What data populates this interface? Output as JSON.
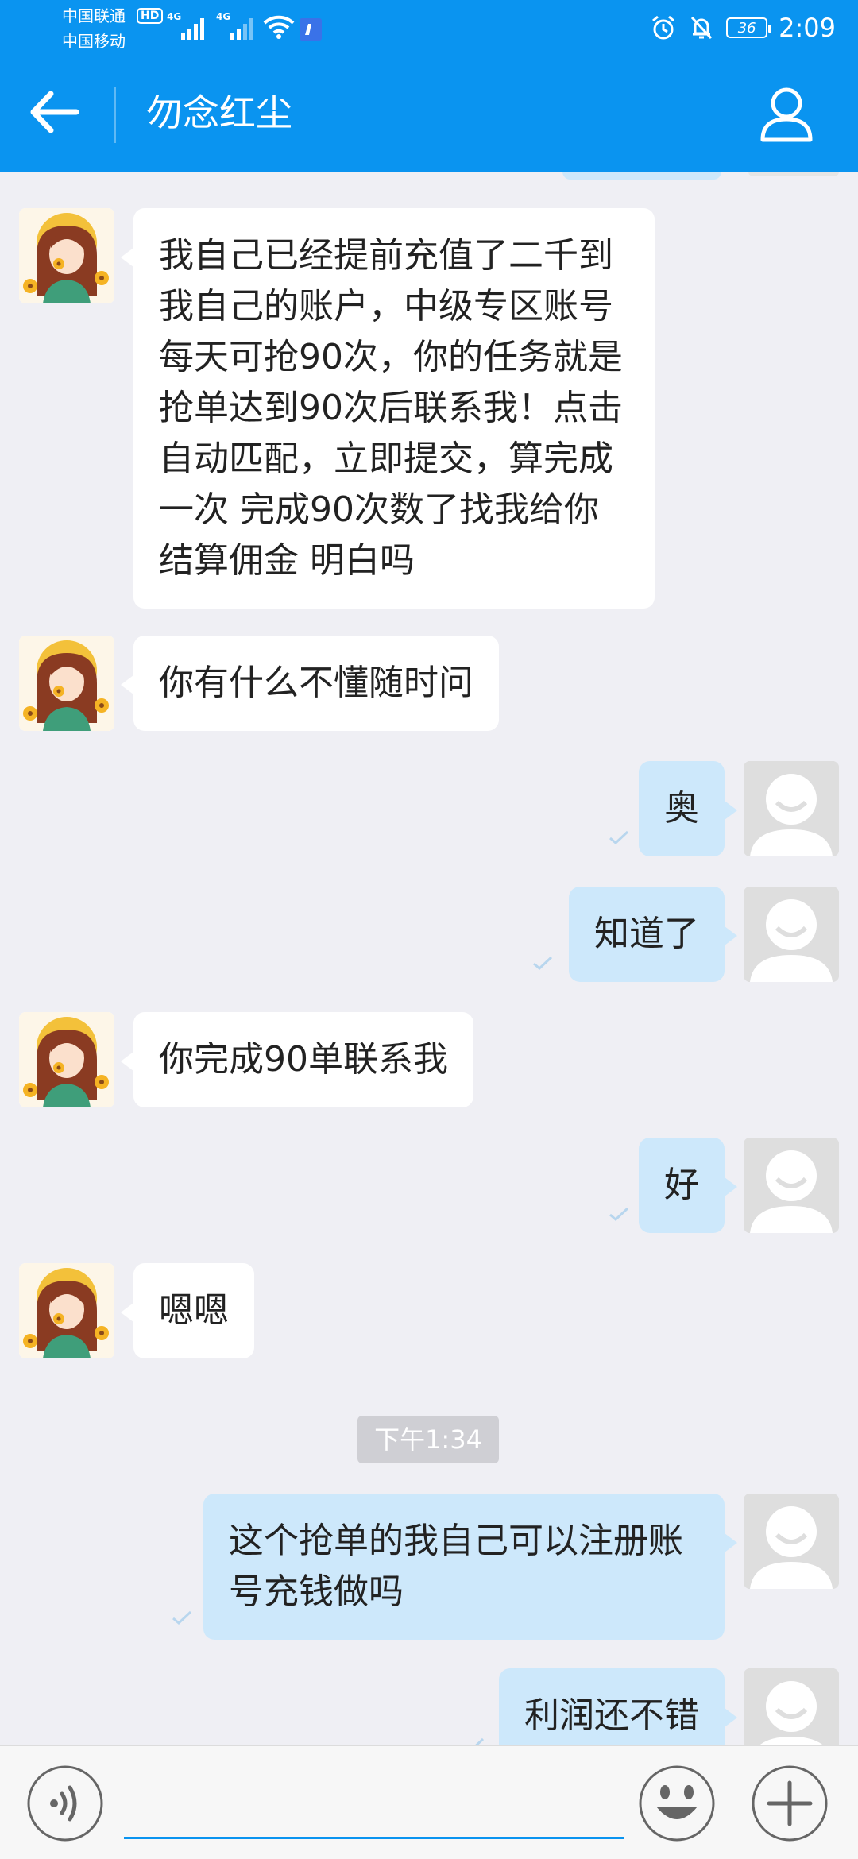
{
  "status_bar": {
    "carrier_1": "中国联通",
    "carrier_2": "中国移动",
    "hd_badge": "HD",
    "network_1": "4G",
    "network_2": "4G",
    "battery": "36",
    "time": "2:09"
  },
  "header": {
    "title": "勿念红尘"
  },
  "messages": [
    {
      "sender": "other",
      "text": "我自己已经提前充值了二千到我自己的账户，中级专区账号每天可抢90次，你的任务就是抢单达到90次后联系我！点击自动匹配，立即提交，算完成一次 完成90次数了找我给你结算佣金 明白吗"
    },
    {
      "sender": "other",
      "text": "你有什么不懂随时问"
    },
    {
      "sender": "me",
      "text": "奥"
    },
    {
      "sender": "me",
      "text": "知道了"
    },
    {
      "sender": "other",
      "text": "你完成90单联系我"
    },
    {
      "sender": "me",
      "text": "好"
    },
    {
      "sender": "other",
      "text": "嗯嗯"
    },
    {
      "sender": "me",
      "text": "这个抢单的我自己可以注册账号充钱做吗"
    },
    {
      "sender": "me",
      "text": "利润还不错"
    }
  ],
  "timestamp": "下午1:34",
  "input": {
    "value": ""
  },
  "colors": {
    "brand_blue": "#0a94f0",
    "my_bubble": "#cde8fb",
    "their_bubble": "#ffffff",
    "background": "#efeff4"
  },
  "icons": {
    "back": "arrow-left-icon",
    "profile": "person-icon",
    "voice": "voice-icon",
    "emoji": "smiley-icon",
    "plus": "plus-icon",
    "sent": "checkmark-icon"
  }
}
